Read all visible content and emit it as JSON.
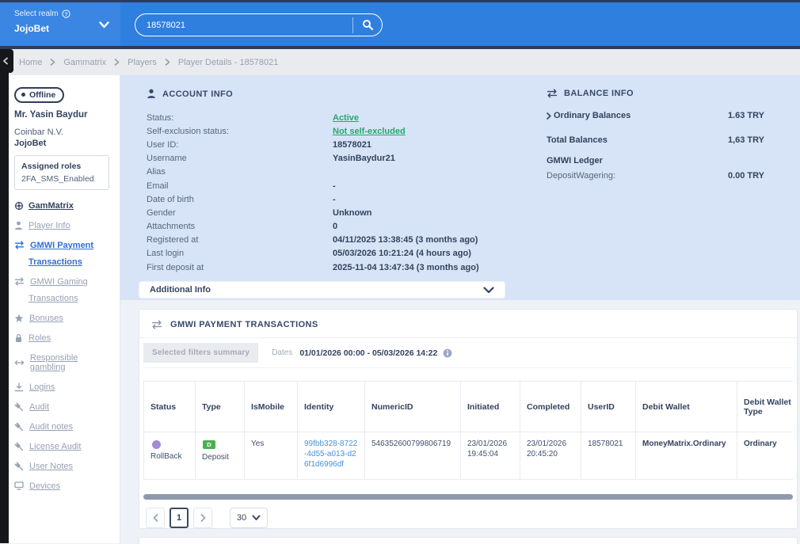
{
  "topbar": {
    "select_realm_label": "Select realm",
    "realm": "JojoBet",
    "search_value": "18578021"
  },
  "breadcrumb": {
    "items": [
      "Home",
      "Gammatrix",
      "Players",
      "Player Details - 18578021"
    ]
  },
  "sidebar": {
    "status_badge": "Offline",
    "player_name": "Mr. Yasin Baydur",
    "operator": "Coinbar N.V.",
    "brand": "JojoBet",
    "roles_title": "Assigned roles",
    "role": "2FA_SMS_Enabled",
    "gammatrix": "GamMatrix",
    "items": [
      {
        "label": "Player Info"
      },
      {
        "label": "GMWI Payment",
        "label2": "Transactions"
      },
      {
        "label": "GMWI Gaming",
        "label2": "Transactions"
      },
      {
        "label": "Bonuses"
      },
      {
        "label": "Roles"
      },
      {
        "label": "Responsible gambling"
      },
      {
        "label": "Logins"
      },
      {
        "label": "Audit"
      },
      {
        "label": "Audit notes"
      },
      {
        "label": "License Audit"
      },
      {
        "label": "User Notes"
      },
      {
        "label": "Devices"
      }
    ]
  },
  "account_info": {
    "title": "ACCOUNT INFO",
    "rows": [
      {
        "label": "Status:",
        "value": "Active"
      },
      {
        "label": "Self-exclusion status:",
        "value": "Not self-excluded"
      },
      {
        "label": "User ID:",
        "value": "18578021"
      },
      {
        "label": "Username",
        "value": "YasinBaydur21"
      },
      {
        "label": "Alias",
        "value": ""
      },
      {
        "label": "Email",
        "value": "-"
      },
      {
        "label": "Date of birth",
        "value": "-"
      },
      {
        "label": "Gender",
        "value": "Unknown"
      },
      {
        "label": "Attachments",
        "value": "0"
      },
      {
        "label": "Registered at",
        "value": "04/11/2025 13:38:45 (3 months ago)"
      },
      {
        "label": "Last login",
        "value": "05/03/2026 10:21:24 (4 hours ago)"
      },
      {
        "label": "First deposit at",
        "value": "2025-11-04 13:47:34 (3 months ago)"
      }
    ]
  },
  "balance_info": {
    "title": "BALANCE INFO",
    "ordinary_label": "Ordinary Balances",
    "ordinary_value": "1.63 TRY",
    "total_label": "Total Balances",
    "total_value": "1,63 TRY",
    "ledger_label": "GMWI Ledger",
    "wagering_label": "DepositWagering:",
    "wagering_value": "0.00 TRY"
  },
  "additional_info": {
    "label": "Additional Info"
  },
  "transactions": {
    "title": "GMWI PAYMENT TRANSACTIONS",
    "filters_summary_label": "Selected filters summary",
    "dates_label": "Dates",
    "dates_value": "01/01/2026 00:00 - 05/03/2026 14:22",
    "columns": [
      "Status",
      "Type",
      "IsMobile",
      "Identity",
      "NumericID",
      "Initiated",
      "Completed",
      "UserID",
      "Debit Wallet",
      "Debit Wallet Type"
    ],
    "row": {
      "status": "RollBack",
      "type_badge": "D",
      "type": "Deposit",
      "is_mobile": "Yes",
      "identity": "99fbb328-8722-4d55-a013-d26f1d6996df",
      "numeric_id": "546352600799806719",
      "initiated": "23/01/2026 19:45:04",
      "completed": "23/01/2026 20:45:20",
      "user_id": "18578021",
      "debit_wallet": "MoneyMatrix.Ordinary",
      "debit_wallet_type": "Ordinary"
    },
    "pagination": {
      "current_page": "1",
      "page_size": "30"
    }
  },
  "colors": {
    "header_blue": "#2f7fdf",
    "panel_blue": "#d7e4f7",
    "green": "#27a86a",
    "purple_status": "#a58bd3",
    "badge_green": "#4daf54",
    "navy_text": "#33435e",
    "link_blue": "#4a90d9"
  }
}
